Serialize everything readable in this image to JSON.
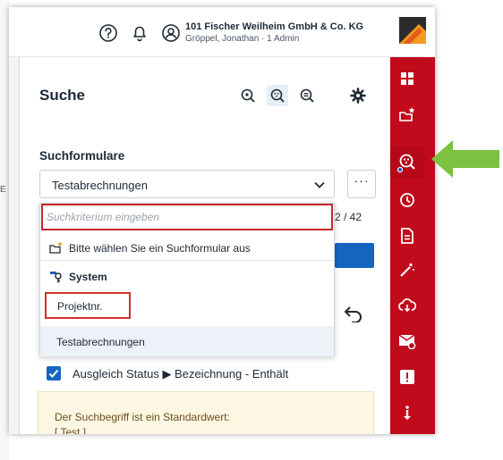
{
  "header": {
    "org_name": "101 Fischer Weilheim GmbH & Co. KG",
    "user_line": "Gröppel, Jonathan · 1 Admin",
    "icons": [
      "help-icon",
      "bell-icon",
      "user-icon"
    ]
  },
  "panel": {
    "title": "Suche",
    "toolbar_icons": [
      "search-simple-icon",
      "search-form-icon",
      "search-list-icon",
      "gear-icon"
    ]
  },
  "search_forms": {
    "label": "Suchformulare",
    "selected": "Testabrechnungen",
    "more_label": "···",
    "count": "2 / 42"
  },
  "dropdown": {
    "placeholder": "Suchkriterium eingeben",
    "hint": "Bitte wählen Sie ein Suchformular aus",
    "group_label": "System",
    "items": [
      "Projektnr.",
      "Testabrechnungen"
    ]
  },
  "criteria": {
    "checkbox_label": "Ausgleich Status ▶ Bezeichnung - Enthält",
    "checked": true
  },
  "info_box": {
    "line1": "Der Suchbegriff ist ein Standardwert:",
    "line2": "[ Test ]"
  },
  "right_nav": {
    "items": [
      "dashboard-icon",
      "favorites-icon",
      "search-icon",
      "history-icon",
      "document-icon",
      "wizard-icon",
      "cloud-sync-icon",
      "mail-icon",
      "alert-icon",
      "info-icon"
    ],
    "active_index": 2
  },
  "side_letter": "E",
  "colors": {
    "brand_red": "#c10a1c",
    "primary_blue": "#1565c0",
    "highlight_red": "#d32f2f",
    "callout_green": "#7cc142",
    "info_bg": "#fdf6e3"
  }
}
